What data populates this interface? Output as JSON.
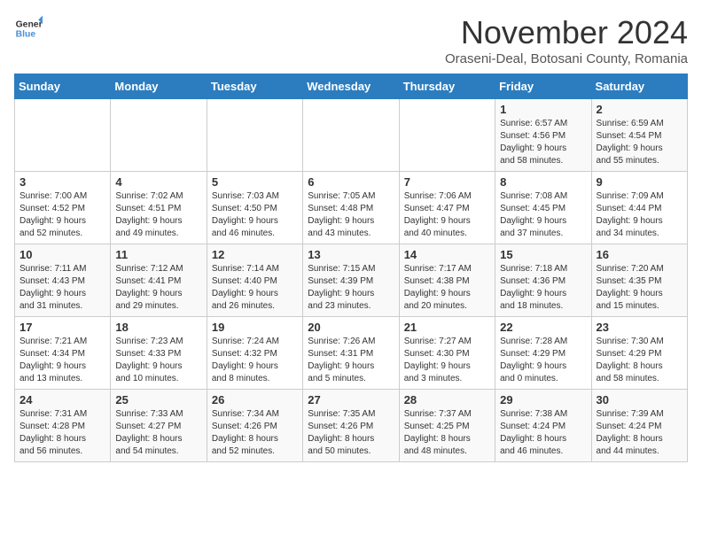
{
  "logo": {
    "line1": "General",
    "line2": "Blue"
  },
  "title": "November 2024",
  "location": "Oraseni-Deal, Botosani County, Romania",
  "weekdays": [
    "Sunday",
    "Monday",
    "Tuesday",
    "Wednesday",
    "Thursday",
    "Friday",
    "Saturday"
  ],
  "weeks": [
    [
      {
        "day": "",
        "info": ""
      },
      {
        "day": "",
        "info": ""
      },
      {
        "day": "",
        "info": ""
      },
      {
        "day": "",
        "info": ""
      },
      {
        "day": "",
        "info": ""
      },
      {
        "day": "1",
        "info": "Sunrise: 6:57 AM\nSunset: 4:56 PM\nDaylight: 9 hours\nand 58 minutes."
      },
      {
        "day": "2",
        "info": "Sunrise: 6:59 AM\nSunset: 4:54 PM\nDaylight: 9 hours\nand 55 minutes."
      }
    ],
    [
      {
        "day": "3",
        "info": "Sunrise: 7:00 AM\nSunset: 4:52 PM\nDaylight: 9 hours\nand 52 minutes."
      },
      {
        "day": "4",
        "info": "Sunrise: 7:02 AM\nSunset: 4:51 PM\nDaylight: 9 hours\nand 49 minutes."
      },
      {
        "day": "5",
        "info": "Sunrise: 7:03 AM\nSunset: 4:50 PM\nDaylight: 9 hours\nand 46 minutes."
      },
      {
        "day": "6",
        "info": "Sunrise: 7:05 AM\nSunset: 4:48 PM\nDaylight: 9 hours\nand 43 minutes."
      },
      {
        "day": "7",
        "info": "Sunrise: 7:06 AM\nSunset: 4:47 PM\nDaylight: 9 hours\nand 40 minutes."
      },
      {
        "day": "8",
        "info": "Sunrise: 7:08 AM\nSunset: 4:45 PM\nDaylight: 9 hours\nand 37 minutes."
      },
      {
        "day": "9",
        "info": "Sunrise: 7:09 AM\nSunset: 4:44 PM\nDaylight: 9 hours\nand 34 minutes."
      }
    ],
    [
      {
        "day": "10",
        "info": "Sunrise: 7:11 AM\nSunset: 4:43 PM\nDaylight: 9 hours\nand 31 minutes."
      },
      {
        "day": "11",
        "info": "Sunrise: 7:12 AM\nSunset: 4:41 PM\nDaylight: 9 hours\nand 29 minutes."
      },
      {
        "day": "12",
        "info": "Sunrise: 7:14 AM\nSunset: 4:40 PM\nDaylight: 9 hours\nand 26 minutes."
      },
      {
        "day": "13",
        "info": "Sunrise: 7:15 AM\nSunset: 4:39 PM\nDaylight: 9 hours\nand 23 minutes."
      },
      {
        "day": "14",
        "info": "Sunrise: 7:17 AM\nSunset: 4:38 PM\nDaylight: 9 hours\nand 20 minutes."
      },
      {
        "day": "15",
        "info": "Sunrise: 7:18 AM\nSunset: 4:36 PM\nDaylight: 9 hours\nand 18 minutes."
      },
      {
        "day": "16",
        "info": "Sunrise: 7:20 AM\nSunset: 4:35 PM\nDaylight: 9 hours\nand 15 minutes."
      }
    ],
    [
      {
        "day": "17",
        "info": "Sunrise: 7:21 AM\nSunset: 4:34 PM\nDaylight: 9 hours\nand 13 minutes."
      },
      {
        "day": "18",
        "info": "Sunrise: 7:23 AM\nSunset: 4:33 PM\nDaylight: 9 hours\nand 10 minutes."
      },
      {
        "day": "19",
        "info": "Sunrise: 7:24 AM\nSunset: 4:32 PM\nDaylight: 9 hours\nand 8 minutes."
      },
      {
        "day": "20",
        "info": "Sunrise: 7:26 AM\nSunset: 4:31 PM\nDaylight: 9 hours\nand 5 minutes."
      },
      {
        "day": "21",
        "info": "Sunrise: 7:27 AM\nSunset: 4:30 PM\nDaylight: 9 hours\nand 3 minutes."
      },
      {
        "day": "22",
        "info": "Sunrise: 7:28 AM\nSunset: 4:29 PM\nDaylight: 9 hours\nand 0 minutes."
      },
      {
        "day": "23",
        "info": "Sunrise: 7:30 AM\nSunset: 4:29 PM\nDaylight: 8 hours\nand 58 minutes."
      }
    ],
    [
      {
        "day": "24",
        "info": "Sunrise: 7:31 AM\nSunset: 4:28 PM\nDaylight: 8 hours\nand 56 minutes."
      },
      {
        "day": "25",
        "info": "Sunrise: 7:33 AM\nSunset: 4:27 PM\nDaylight: 8 hours\nand 54 minutes."
      },
      {
        "day": "26",
        "info": "Sunrise: 7:34 AM\nSunset: 4:26 PM\nDaylight: 8 hours\nand 52 minutes."
      },
      {
        "day": "27",
        "info": "Sunrise: 7:35 AM\nSunset: 4:26 PM\nDaylight: 8 hours\nand 50 minutes."
      },
      {
        "day": "28",
        "info": "Sunrise: 7:37 AM\nSunset: 4:25 PM\nDaylight: 8 hours\nand 48 minutes."
      },
      {
        "day": "29",
        "info": "Sunrise: 7:38 AM\nSunset: 4:24 PM\nDaylight: 8 hours\nand 46 minutes."
      },
      {
        "day": "30",
        "info": "Sunrise: 7:39 AM\nSunset: 4:24 PM\nDaylight: 8 hours\nand 44 minutes."
      }
    ]
  ]
}
